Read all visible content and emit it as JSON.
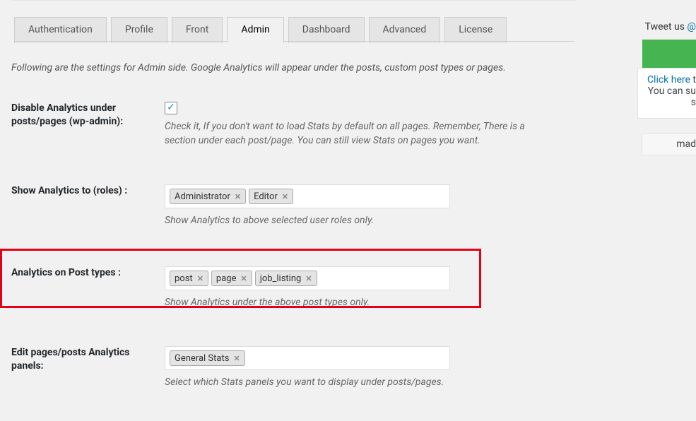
{
  "tabs": [
    "Authentication",
    "Profile",
    "Front",
    "Admin",
    "Dashboard",
    "Advanced",
    "License"
  ],
  "active_tab": 3,
  "intro": "Following are the settings for Admin side. Google Analytics will appear under the posts, custom post types or pages.",
  "settings": {
    "disable": {
      "label": "Disable Analytics under posts/pages (wp-admin):",
      "help": "Check it, If you don't want to load Stats by default on all pages. Remember, There is a section under each post/page. You can still view Stats on pages you want."
    },
    "roles": {
      "label": "Show Analytics to (roles) :",
      "tags": [
        "Administrator",
        "Editor"
      ],
      "help": "Show Analytics to above selected user roles only."
    },
    "post_types": {
      "label": "Analytics on Post types :",
      "tags": [
        "post",
        "page",
        "job_listing"
      ],
      "help": "Show Analytics under the above post types only."
    },
    "panels": {
      "label": "Edit pages/posts Analytics panels:",
      "tags": [
        "General Stats"
      ],
      "help": "Select which Stats panels you want to display under posts/pages."
    }
  },
  "sidebar": {
    "tweet_pre": "Tweet us ",
    "tweet_at": "@",
    "click_link": "Click here",
    "click_tail": " t",
    "line2": "You can su",
    "line3": "s",
    "mad": "mad"
  }
}
